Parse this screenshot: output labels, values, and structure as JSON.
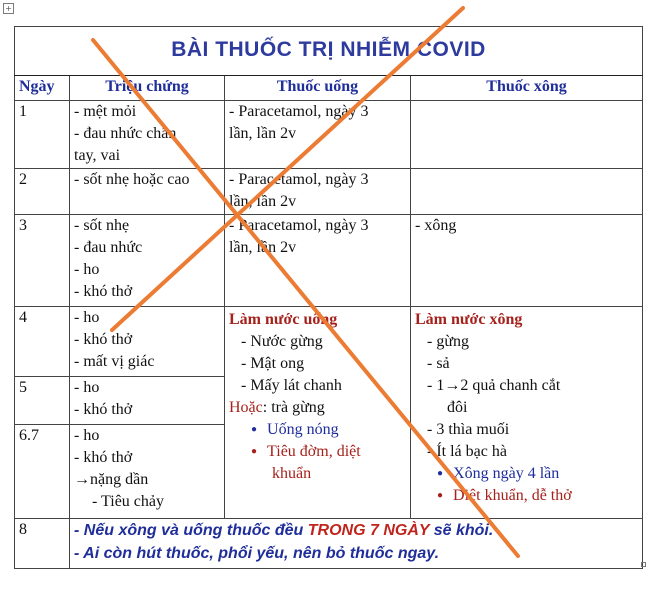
{
  "title": "BÀI THUỐC TRỊ NHIỄM COVID",
  "headers": [
    "Ngày",
    "Triệu chứng",
    "Thuốc uống",
    "Thuốc xông"
  ],
  "rows": [
    {
      "day": "1",
      "symptoms": [
        "- mệt mỏi",
        "- đau nhức chân",
        "tay, vai"
      ],
      "drink": [
        "- Paracetamol, ngày 3",
        "lần, lần 2v"
      ],
      "steam": []
    },
    {
      "day": "2",
      "symptoms": [
        "- sốt nhẹ hoặc cao"
      ],
      "drink": [
        "- Paracetamol, ngày 3",
        "lần, lần 2v"
      ],
      "steam": []
    },
    {
      "day": "3",
      "symptoms": [
        "- sốt nhẹ",
        "- đau nhức",
        "- ho",
        "- khó thở"
      ],
      "drink": [
        "- Paracetamol, ngày 3",
        "lần, lần 2v"
      ],
      "steam": [
        "- xông"
      ]
    },
    {
      "day": "4",
      "symptoms": [
        "- ho",
        "- khó thở",
        "- mất vị giác"
      ]
    },
    {
      "day": "5",
      "symptoms": [
        "- ho",
        "- khó thở"
      ]
    },
    {
      "day": "6.7",
      "symptoms": [
        "- ho",
        "- khó thở",
        "→nặng dần",
        "- Tiêu chảy"
      ]
    }
  ],
  "drink_recipe": {
    "heading": "Làm nước uống",
    "items": [
      "- Nước gừng",
      "- Mật ong",
      "- Mấy lát chanh"
    ],
    "alt_label": "Hoặc",
    "alt_text": ": trà gừng",
    "bullets": [
      "Uống nóng",
      "Tiêu đờm, diệt",
      "khuẩn"
    ]
  },
  "steam_recipe": {
    "heading": "Làm nước xông",
    "items": [
      "- gừng",
      "- sả",
      "- 1→2 quả chanh cắt",
      "đôi",
      "- 3 thìa muối",
      "- Ít lá bạc hà"
    ],
    "bullets": [
      "Xông ngày 4 lần",
      "Diệt khuẩn, dễ thở"
    ]
  },
  "final_row": {
    "day": "8",
    "note1_a": "- Nếu xông và uống thuốc đều ",
    "note1_em": "TRONG 7 NGÀY",
    "note1_b": " sẽ khỏi.",
    "note2": "- Ai còn hút thuốc, phổi yếu, nên bỏ thuốc ngay."
  },
  "colors": {
    "cross": "#ec7c33",
    "title": "#2d3a9e",
    "header": "#1f2e9a",
    "recipe_red": "#a5211c"
  },
  "icons": {
    "table_anchor": "move-handle-icon"
  }
}
